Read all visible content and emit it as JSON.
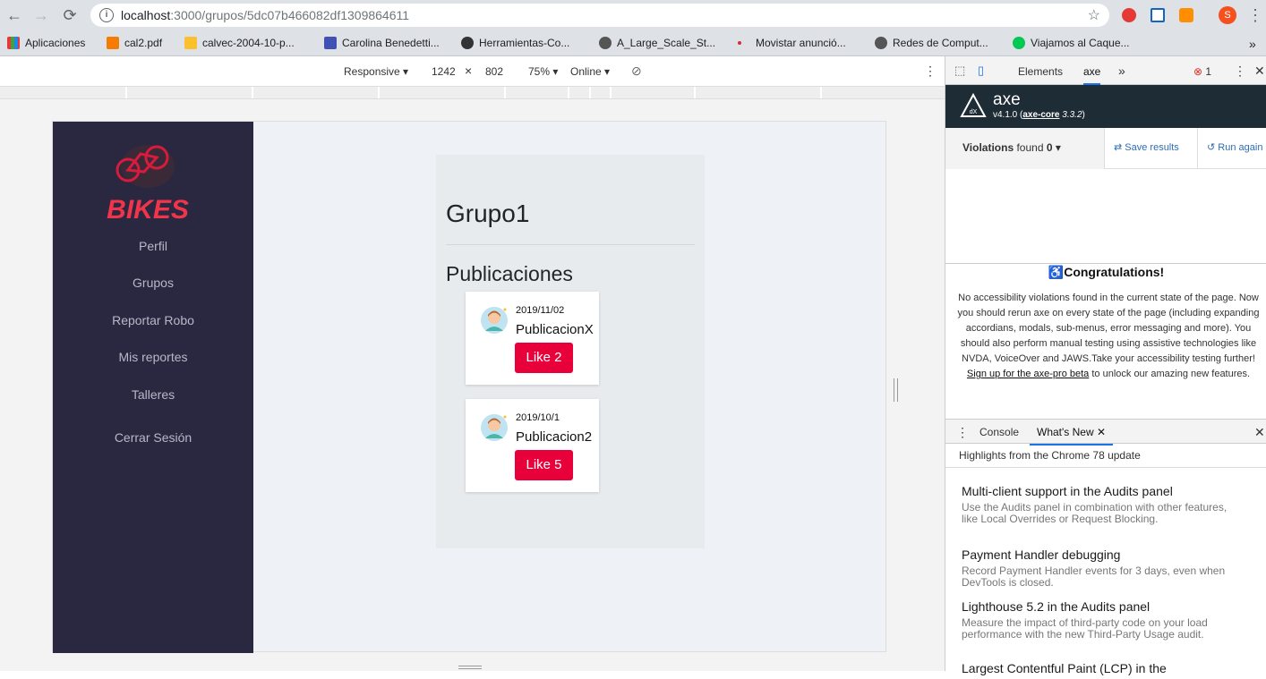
{
  "browser": {
    "url_host": "localhost",
    "url_path": ":3000/grupos/5dc07b466082df1309864611",
    "info_icon": "info-icon",
    "bookmarks": [
      {
        "label": "Aplicaciones",
        "color": "#e53935"
      },
      {
        "label": "cal2.pdf",
        "color": "#f57c00"
      },
      {
        "label": "calvec-2004-10-p...",
        "color": "#fbc02d"
      },
      {
        "label": "Carolina Benedetti...",
        "color": "#3f51b5"
      },
      {
        "label": "Herramientas-Co...",
        "color": "#333333"
      },
      {
        "label": "A_Large_Scale_St...",
        "color": "#555555"
      },
      {
        "label": "Movistar anunció...",
        "color": "#d32f2f"
      },
      {
        "label": "Redes de Comput...",
        "color": "#555555"
      },
      {
        "label": "Viajamos al Caque...",
        "color": "#00c853"
      }
    ],
    "profile_initial": "S"
  },
  "device_toolbar": {
    "mode": "Responsive",
    "width": "1242",
    "height": "802",
    "zoom": "75%",
    "network": "Online"
  },
  "app": {
    "logo_text": "BIKES",
    "nav": [
      "Perfil",
      "Grupos",
      "Reportar Robo",
      "Mis reportes",
      "Talleres",
      "Cerrar Sesión"
    ],
    "group_title": "Grupo1",
    "section_heading": "Publicaciones",
    "posts": [
      {
        "date": "2019/11/02",
        "title": "PublicacionX",
        "like_label": "Like 2"
      },
      {
        "date": "2019/10/1",
        "title": "Publicacion2",
        "like_label": "Like 5"
      }
    ],
    "accent": "#e8003b",
    "sidebar_color": "#2a2741"
  },
  "devtools": {
    "tabs": [
      "Elements",
      "axe"
    ],
    "error_count": "1",
    "axe": {
      "name": "axe",
      "version": "v4.1.0",
      "core": "axe-core",
      "core_version": "3.3.2",
      "violations_label": "Violations",
      "violations_found": "found",
      "violations_count": "0",
      "save_label": "Save results",
      "run_label": "Run again",
      "congrats_title": "Congratulations!",
      "congrats_part1": "No accessibility violations found in the current state of the page. Now you should rerun axe on every state of the page (including expanding accordians, modals, sub-menus, error messaging and more). You should also perform manual testing using assistive technologies like NVDA, VoiceOver and JAWS.Take your accessibility testing further!",
      "congrats_link": "Sign up for the axe-pro beta",
      "congrats_part2": "to unlock our amazing new features."
    },
    "drawer_tabs": [
      "Console",
      "What's New"
    ],
    "drawer_subtitle": "Highlights from the Chrome 78 update",
    "whats_new": [
      {
        "title": "Multi-client support in the Audits panel",
        "desc": "Use the Audits panel in combination with other features, like Local Overrides or Request Blocking."
      },
      {
        "title": "Payment Handler debugging",
        "desc": "Record Payment Handler events for 3 days, even when DevTools is closed."
      },
      {
        "title": "Lighthouse 5.2 in the Audits panel",
        "desc": "Measure the impact of third-party code on your load performance with the new Third-Party Usage audit."
      },
      {
        "title": "Largest Contentful Paint (LCP) in the",
        "desc": ""
      }
    ]
  }
}
